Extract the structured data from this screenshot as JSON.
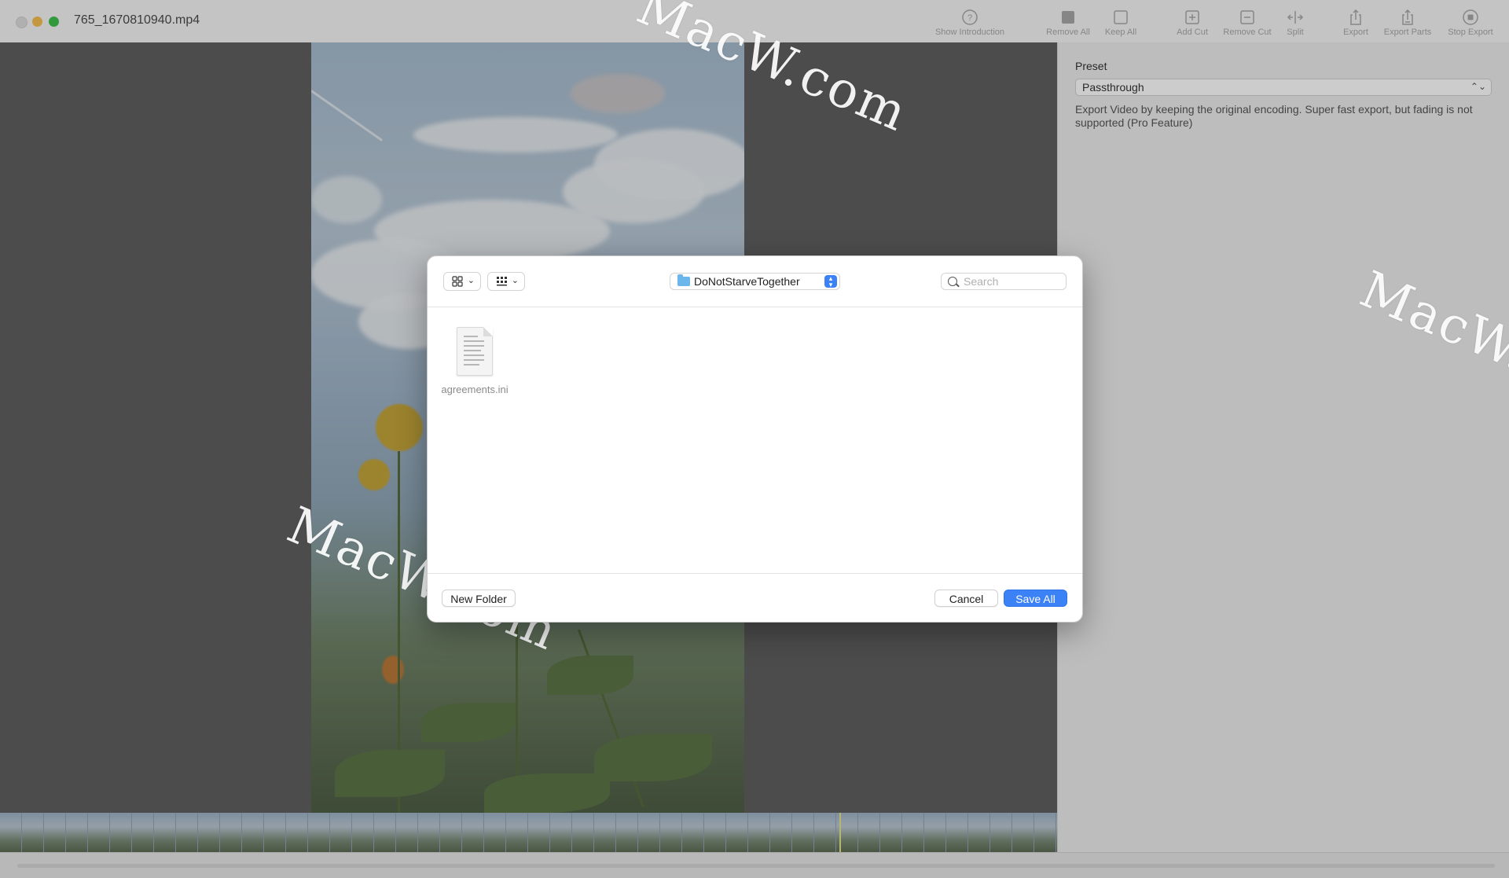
{
  "window": {
    "title": "765_1670810940.mp4"
  },
  "toolbar": {
    "items": [
      {
        "label": "Show Introduction",
        "icon": "question-circle-icon"
      },
      {
        "label": "Remove All",
        "icon": "filled-square-icon"
      },
      {
        "label": "Keep All",
        "icon": "empty-square-icon"
      },
      {
        "label": "Add Cut",
        "icon": "plus-square-icon"
      },
      {
        "label": "Remove Cut",
        "icon": "minus-square-icon"
      },
      {
        "label": "Split",
        "icon": "split-icon"
      },
      {
        "label": "Export",
        "icon": "share-icon"
      },
      {
        "label": "Export Parts",
        "icon": "share-multiple-icon"
      },
      {
        "label": "Stop Export",
        "icon": "stop-circle-icon"
      }
    ]
  },
  "side_panel": {
    "preset_label": "Preset",
    "preset_value": "Passthrough",
    "preset_description": "Export Video by keeping the original encoding. Super fast export, but fading is not supported (Pro Feature)"
  },
  "dialog": {
    "location": "DoNotStarveTogether",
    "search_placeholder": "Search",
    "files": [
      {
        "name": "agreements.ini",
        "icon": "document-icon"
      }
    ],
    "new_folder_label": "New Folder",
    "cancel_label": "Cancel",
    "save_label": "Save All"
  },
  "watermark": "MacW.com",
  "colors": {
    "accent": "#3b82f6",
    "folder": "#6bb6ea"
  }
}
